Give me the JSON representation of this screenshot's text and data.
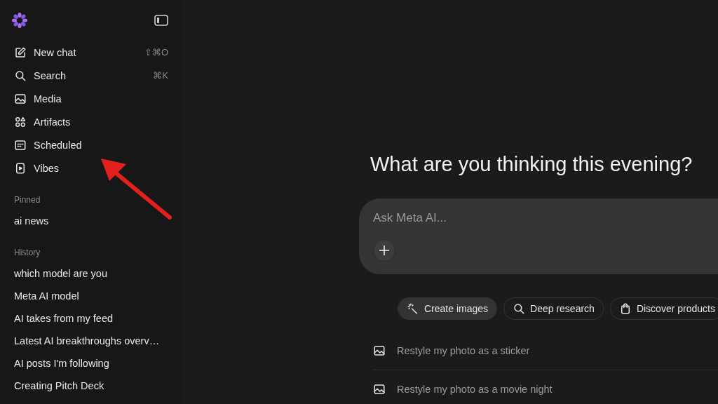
{
  "sidebar": {
    "nav": [
      {
        "kind": "edit",
        "label": "New chat",
        "shortcut": "⇧⌘O"
      },
      {
        "kind": "search",
        "label": "Search",
        "shortcut": "⌘K"
      },
      {
        "kind": "media",
        "label": "Media"
      },
      {
        "kind": "artifacts",
        "label": "Artifacts"
      },
      {
        "kind": "calendar",
        "label": "Scheduled"
      },
      {
        "kind": "play",
        "label": "Vibes"
      }
    ],
    "sections": [
      {
        "title": "Pinned",
        "items": [
          "ai news"
        ]
      },
      {
        "title": "History",
        "items": [
          "which model are you",
          "Meta AI model",
          "AI takes from my feed",
          "Latest AI breakthroughs overv…",
          "AI posts I'm following",
          "Creating Pitch Deck"
        ]
      }
    ]
  },
  "main": {
    "heading": "What are you thinking this evening?",
    "composer": {
      "placeholder": "Ask Meta AI..."
    },
    "chips": [
      {
        "kind": "wand",
        "label": "Create images",
        "selected": true
      },
      {
        "kind": "search",
        "label": "Deep research",
        "selected": false
      },
      {
        "kind": "bag",
        "label": "Discover products",
        "selected": false
      }
    ],
    "suggestions": [
      "Restyle my photo as a sticker",
      "Restyle my photo as a movie night"
    ]
  }
}
